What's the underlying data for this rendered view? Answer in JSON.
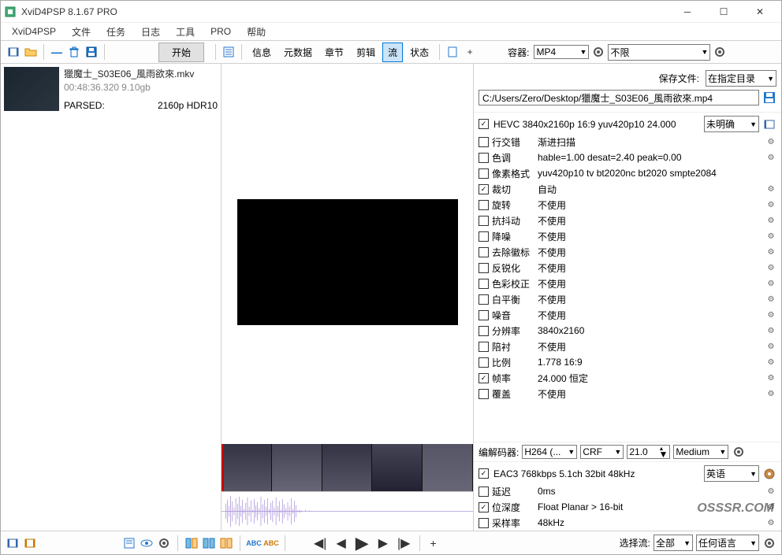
{
  "window": {
    "title": "XviD4PSP 8.1.67 PRO"
  },
  "menu": {
    "items": [
      "XviD4PSP",
      "文件",
      "任务",
      "日志",
      "工具",
      "PRO",
      "帮助"
    ]
  },
  "toolbar": {
    "start": "开始",
    "tabs": [
      "信息",
      "元数据",
      "章节",
      "剪辑",
      "流",
      "状态"
    ],
    "active_tab": 4,
    "container_label": "容器:",
    "container_value": "MP4",
    "limit_value": "不限"
  },
  "file": {
    "name": "獵魔士_S03E06_風雨欲來.mkv",
    "duration": "00:48:36.320",
    "size": "9.10gb",
    "parsed_label": "PARSED:",
    "parsed_value": "2160p HDR10"
  },
  "output": {
    "save_label": "保存文件:",
    "save_mode": "在指定目录",
    "path": "C:/Users/Zero/Desktop/獵魔士_S03E06_風雨欲來.mp4"
  },
  "video_stream": {
    "checked": true,
    "summary": "HEVC 3840x2160p 16:9 yuv420p10 24.000",
    "clarity": "未明确"
  },
  "props": [
    {
      "chk": false,
      "name": "行交错",
      "val": "渐进扫描",
      "slider": true
    },
    {
      "chk": false,
      "name": "色调",
      "val": "hable=1.00 desat=2.40 peak=0.00",
      "slider": true
    },
    {
      "chk": false,
      "name": "像素格式",
      "val": "yuv420p10 tv bt2020nc bt2020 smpte2084",
      "slider": false
    },
    {
      "chk": true,
      "name": "裁切",
      "val": "自动",
      "slider": true
    },
    {
      "chk": false,
      "name": "旋转",
      "val": "不使用",
      "slider": true
    },
    {
      "chk": false,
      "name": "抗抖动",
      "val": "不使用",
      "slider": true
    },
    {
      "chk": false,
      "name": "降噪",
      "val": "不使用",
      "slider": true
    },
    {
      "chk": false,
      "name": "去除徽标",
      "val": "不使用",
      "slider": true
    },
    {
      "chk": false,
      "name": "反锐化",
      "val": "不使用",
      "slider": true
    },
    {
      "chk": false,
      "name": "色彩校正",
      "val": "不使用",
      "slider": true
    },
    {
      "chk": false,
      "name": "白平衡",
      "val": "不使用",
      "slider": true
    },
    {
      "chk": false,
      "name": "噪音",
      "val": "不使用",
      "slider": true
    },
    {
      "chk": false,
      "name": "分辨率",
      "val": "3840x2160",
      "slider": true
    },
    {
      "chk": false,
      "name": "陪衬",
      "val": "不使用",
      "slider": true
    },
    {
      "chk": false,
      "name": "比例",
      "val": "1.778 16:9",
      "slider": true
    },
    {
      "chk": true,
      "name": "帧率",
      "val": "24.000 恒定",
      "slider": true
    },
    {
      "chk": false,
      "name": "覆盖",
      "val": "不使用",
      "slider": true
    }
  ],
  "encoder": {
    "label": "编解码器:",
    "codec": "H264 (...",
    "mode": "CRF",
    "value": "21.0",
    "preset": "Medium"
  },
  "audio_stream": {
    "checked": true,
    "summary": "EAC3 768kbps 5.1ch 32bit 48kHz",
    "lang": "英语"
  },
  "audio_props": [
    {
      "chk": false,
      "name": "延迟",
      "val": "0ms"
    },
    {
      "chk": true,
      "name": "位深度",
      "val": "Float Planar > 16-bit"
    },
    {
      "chk": false,
      "name": "采样率",
      "val": "48kHz"
    }
  ],
  "bottom": {
    "select_stream": "选择流:",
    "stream_all": "全部",
    "any_lang": "任何语言"
  },
  "watermark": "OSSSR.COM"
}
